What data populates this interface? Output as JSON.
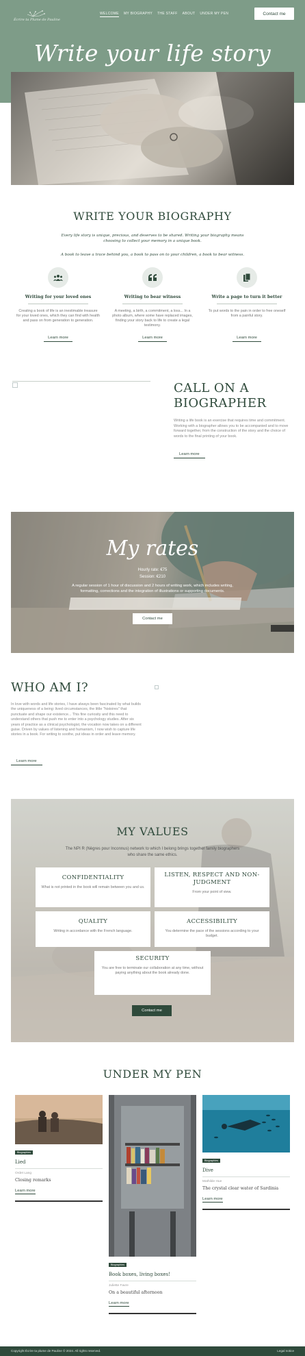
{
  "colors": {
    "accent": "#7e9c88",
    "dark_green": "#2f4a3b",
    "white": "#ffffff"
  },
  "header": {
    "logo_text": "Écrire ta Plume de Pauline",
    "logo_icon": "dandelion-icon",
    "nav": [
      "WELCOME",
      "MY BIOGRAPHY",
      "THE STAFF",
      "ABOUT",
      "UNDER MY PEN"
    ],
    "contact_label": "Contact me"
  },
  "hero": {
    "title": "Write your life story"
  },
  "biography": {
    "title": "WRITE YOUR BIOGRAPHY",
    "subtitle": "Every life story is unique, precious, and deserves to be shared. Writing your biography means choosing to collect your memory in a unique book.",
    "tagline": "A book to leave a trace behind you, a book to pass on to your children, a book to bear witness.",
    "features": [
      {
        "icon": "people-icon",
        "title": "Writing for your loved ones",
        "text": "Creating a book of life is an inestimable treasure for your loved ones, which they can find with health and pass on from generation to generation.",
        "link": "Learn more"
      },
      {
        "icon": "quote-icon",
        "title": "Writing to bear witness",
        "text": "A meeting, a birth, a commitment, a loss... In a photo album, where some have replaced images, finding your story back to life to create a legal testimony.",
        "link": "Learn more"
      },
      {
        "icon": "documents-icon",
        "title": "Write a page to turn it better",
        "text": "To put words to the pain in order to free oneself from a painful story.",
        "link": "Learn more"
      }
    ]
  },
  "call": {
    "title": "CALL ON A BIOGRAPHER",
    "text": "Writing a life book is an exercise that requires time and commitment. Working with a biographer allows you to be accompanied and to move forward together, from the construction of the story and the choice of words to the final printing of your book.",
    "link": "Learn more"
  },
  "rates": {
    "title": "My rates",
    "hourly": "Hourly rate: €75",
    "session": "Session: €210",
    "description": "A regular session of 1 hour of discussion and 2 hours of writing work, which includes writing, formatting, corrections and the integration of illustrations or supporting documents.",
    "button": "Contact me"
  },
  "who": {
    "title": "WHO AM I?",
    "text": "In love with words and life stories, I have always been fascinated by what builds the uniqueness of a being: lived circumstances, the little \"histoires\" that punctuate and shape our existence... This fine curiosity and this need to understand others that push me to enter into a psychology studies. After six years of practice as a clinical psychologist, the vocation now takes on a different guise. Driven by values of listening and humanism, I now wish to capture life stories in a book. For writing to soothe, put ideas in order and leave memory.",
    "link": "Learn more"
  },
  "values": {
    "title": "MY VALUES",
    "intro": "The NPI R (Nègres pour Inconnus) network to which I belong brings together family biographers who share the same ethics.",
    "cards": [
      {
        "title": "CONFIDENTIALITY",
        "desc": "What is not printed in the book will remain between you and us."
      },
      {
        "title": "LISTEN, RESPECT AND NON-JUDGMENT",
        "desc": "From your point of view."
      },
      {
        "title": "QUALITY",
        "desc": "Writing in accordance with the French language."
      },
      {
        "title": "ACCESSIBILITY",
        "desc": "You determine the pace of the sessions according to your budget."
      },
      {
        "title": "SECURITY",
        "desc": "You are free to terminate our collaboration at any time, without paying anything about the book already done."
      }
    ],
    "button": "Contact me"
  },
  "pen": {
    "title": "UNDER MY PEN",
    "posts": [
      {
        "tag": "Biographies",
        "title": "Lied",
        "author": "Ordet Lang",
        "excerpt": "Closing remarks",
        "link": "Learn more"
      },
      {
        "tag": "Biographies",
        "title": "Book boxes, living boxes!",
        "author": "Juliette Favre",
        "excerpt": "On a beautiful afternoon",
        "link": "Learn more"
      },
      {
        "tag": "Biographies",
        "title": "Dive",
        "author": "Mathilde Hue",
        "excerpt": "The crystal clear water of Sardinia",
        "link": "Learn more"
      }
    ]
  },
  "footer": {
    "copyright": "Copyright Écrire ta plume de Pauline © 2024. All rights reserved.",
    "legal": "Legal notice"
  }
}
